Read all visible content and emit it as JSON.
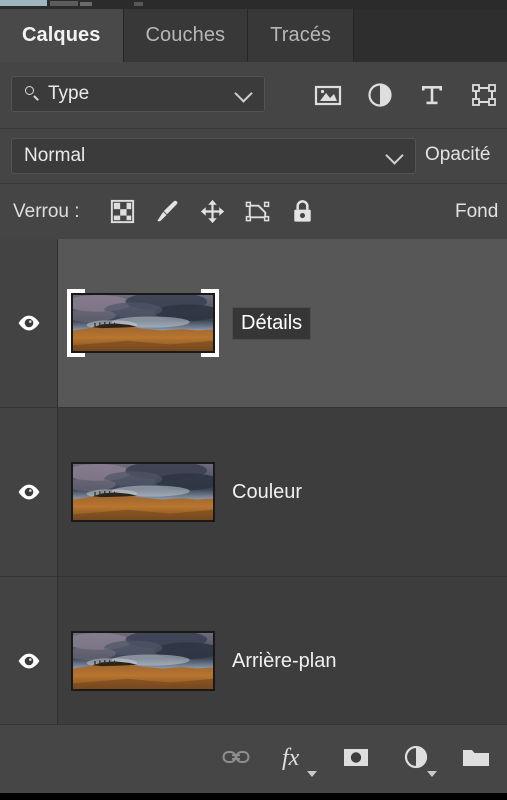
{
  "panel": {
    "title": "Calques",
    "background_color": "#434343",
    "selected_row_color": "#575757"
  },
  "tabs": [
    {
      "label": "Calques",
      "active": true
    },
    {
      "label": "Couches",
      "active": false
    },
    {
      "label": "Tracés",
      "active": false
    }
  ],
  "filter": {
    "search_icon": "search-icon",
    "value": "Type",
    "chevron": "chevron-down-icon",
    "type_filters": [
      {
        "name": "pixel-layer-filter-icon",
        "label": "Pixels"
      },
      {
        "name": "adjustment-layer-filter-icon",
        "label": "Réglage"
      },
      {
        "name": "type-layer-filter-icon",
        "label": "Texte"
      },
      {
        "name": "shape-layer-filter-icon",
        "label": "Forme"
      }
    ]
  },
  "blend": {
    "mode": "Normal",
    "chevron": "chevron-down-icon",
    "opacity_label": "Opacité"
  },
  "lock": {
    "label": "Verrou :",
    "fill_label": "Fond",
    "icons": [
      {
        "name": "lock-transparency-icon",
        "label": "Verrouiller les pixels transparents"
      },
      {
        "name": "lock-image-icon",
        "label": "Verrouiller les pixels de l'image"
      },
      {
        "name": "lock-position-icon",
        "label": "Verrouiller la position"
      },
      {
        "name": "lock-artboard-icon",
        "label": "Empêcher l'imbrication automatique"
      },
      {
        "name": "lock-all-icon",
        "label": "Tout verrouiller"
      }
    ]
  },
  "layers": [
    {
      "name": "Détails",
      "visible": true,
      "selected": true,
      "editing": true,
      "thumbnail": "landscape-thumbnail"
    },
    {
      "name": "Couleur",
      "visible": true,
      "selected": false,
      "editing": false,
      "thumbnail": "landscape-thumbnail"
    },
    {
      "name": "Arrière-plan",
      "visible": true,
      "selected": false,
      "editing": false,
      "thumbnail": "landscape-thumbnail"
    }
  ],
  "bottom_toolbar": [
    {
      "name": "link-layers-icon",
      "label": "Lier les calques",
      "caret": false
    },
    {
      "name": "layer-style-fx-icon",
      "label": "Ajouter un style de calque",
      "caret": true
    },
    {
      "name": "layer-mask-icon",
      "label": "Ajouter un masque de fusion",
      "caret": false
    },
    {
      "name": "new-adjustment-layer-icon",
      "label": "Créer un calque de remplissage ou de réglage",
      "caret": true
    },
    {
      "name": "new-group-icon",
      "label": "Créer un groupe",
      "caret": false
    }
  ]
}
